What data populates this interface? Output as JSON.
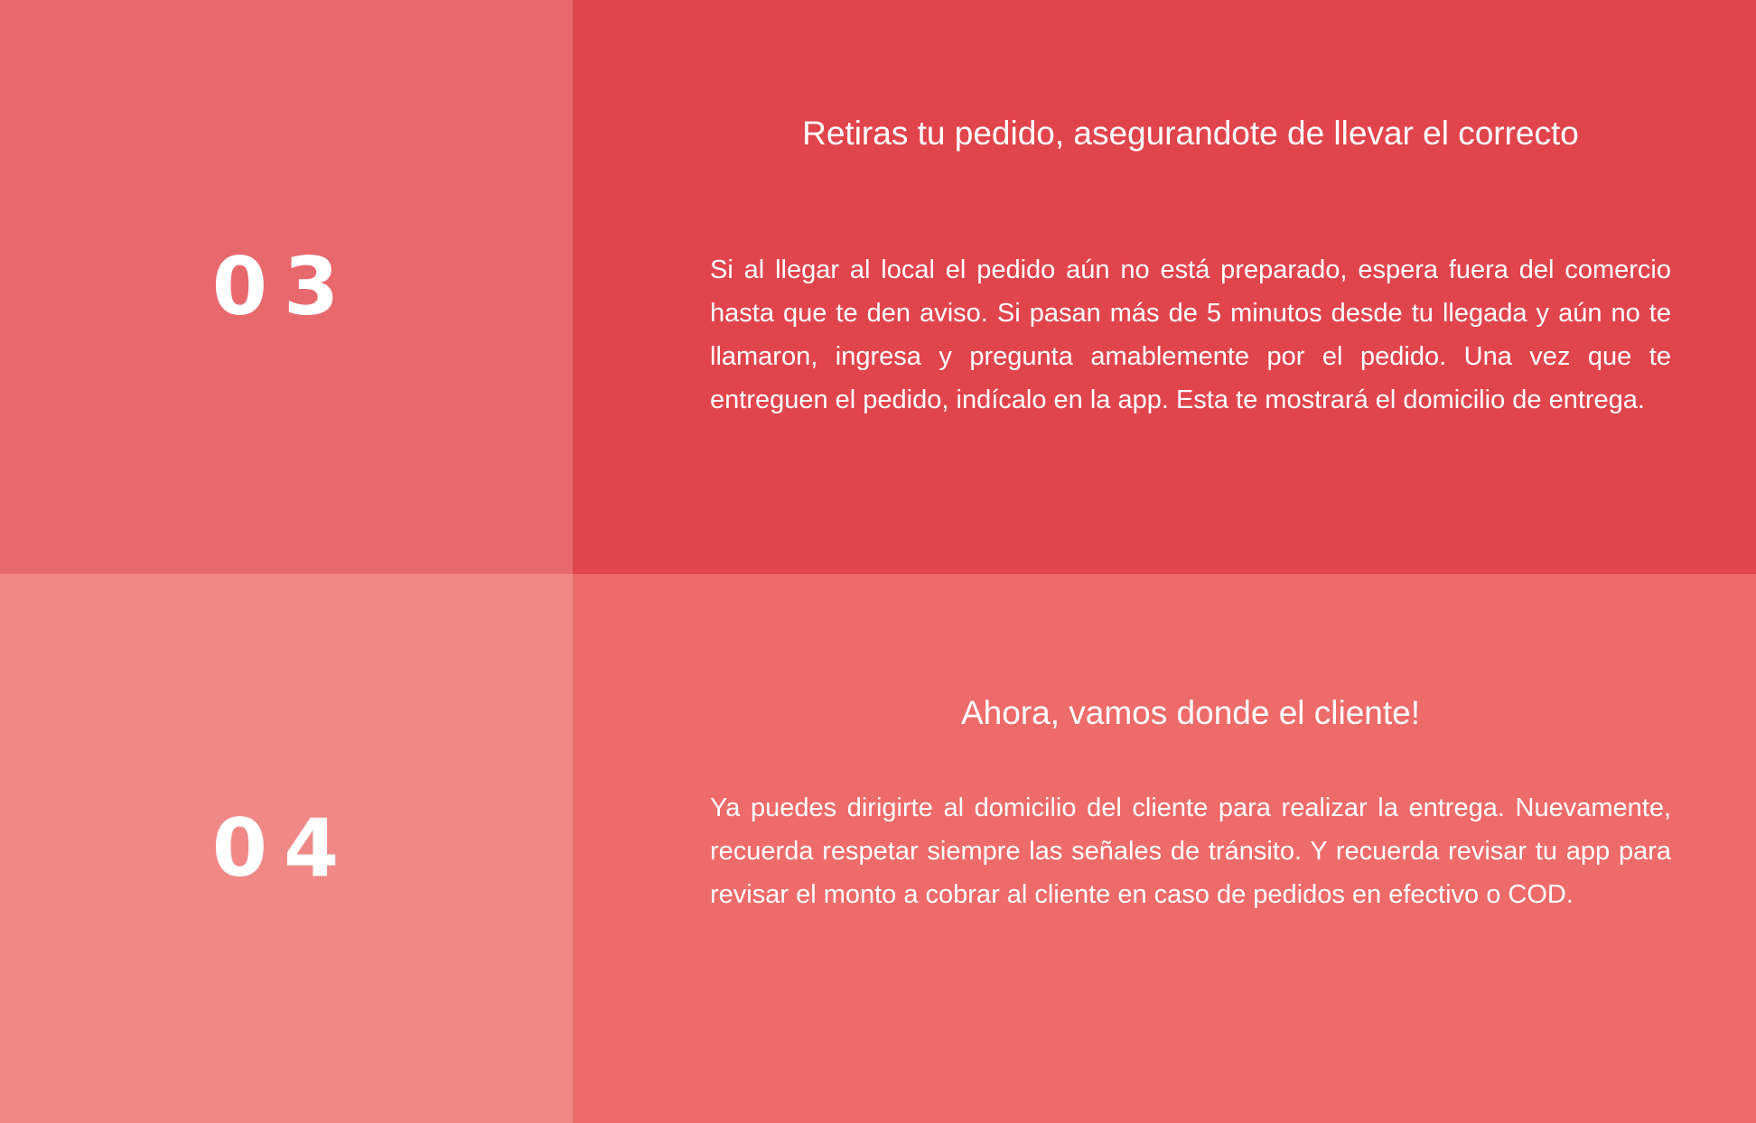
{
  "steps": [
    {
      "number": "03",
      "title": "Retiras tu pedido, asegurandote de llevar el correcto",
      "text": "Si al llegar al local el pedido aún no está preparado, espera fuera del comercio hasta que te den aviso. Si pasan más de 5 minutos desde tu llegada y aún no te llamaron, ingresa y pregunta amablemente por el pedido. Una vez que te entreguen el pedido, indícalo en la app. Esta te mostrará el domicilio de entrega."
    },
    {
      "number": "04",
      "title": "Ahora, vamos donde el cliente!",
      "text": "Ya puedes dirigirte al domicilio del cliente para realizar la entrega. Nuevamente, recuerda respetar siempre las señales de tránsito. Y recuerda revisar tu app para revisar el monto a cobrar al cliente en caso de pedidos en efectivo o COD."
    }
  ],
  "colors": {
    "step3_number_bg": "#e8696c",
    "step3_content_bg": "#e0454b",
    "step4_number_bg": "#f08986",
    "step4_content_bg": "#ed6b68",
    "text": "#ffffff"
  }
}
